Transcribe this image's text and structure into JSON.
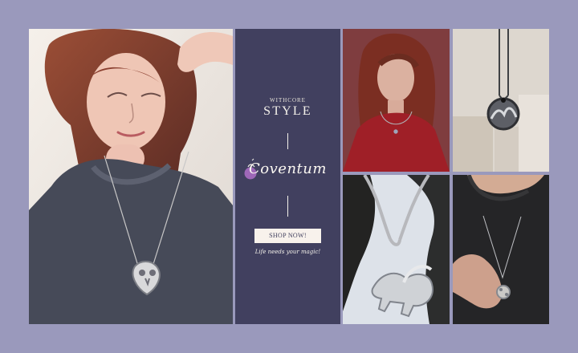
{
  "hero": {
    "eyebrow": "WITHCORE",
    "headline": "STYLE",
    "brand": "Coventum",
    "cta": "SHOP NOW!",
    "tagline": "Life needs your magic!"
  }
}
